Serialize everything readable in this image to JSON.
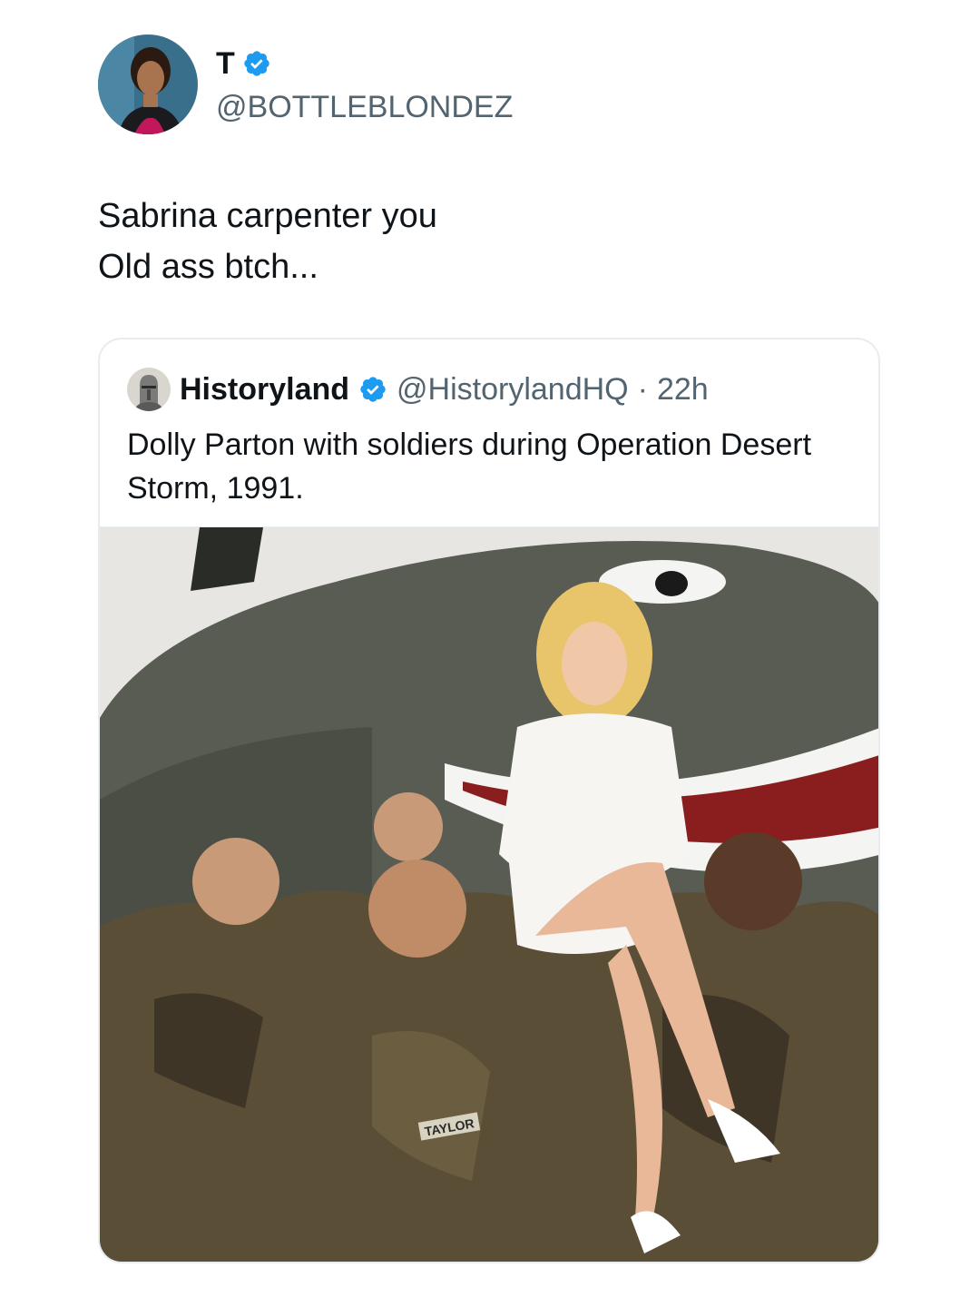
{
  "tweet": {
    "author": {
      "display_name": "T",
      "handle": "@BOTTLEBLONDEZ",
      "verified": true
    },
    "text_lines": [
      "Sabrina carpenter you",
      "Old ass btch..."
    ]
  },
  "quoted_tweet": {
    "author": {
      "display_name": "Historyland",
      "handle": "@HistorylandHQ",
      "verified": true
    },
    "separator": "·",
    "time": "22h",
    "text": "Dolly Parton with soldiers during Operation Desert Storm, 1991.",
    "photo": {
      "patch_text_1": "TAYLOR"
    }
  },
  "colors": {
    "verified_blue": "#1d9bf0",
    "secondary_text": "#536471",
    "primary_text": "#0f1419",
    "card_border": "#e6ecf0"
  }
}
